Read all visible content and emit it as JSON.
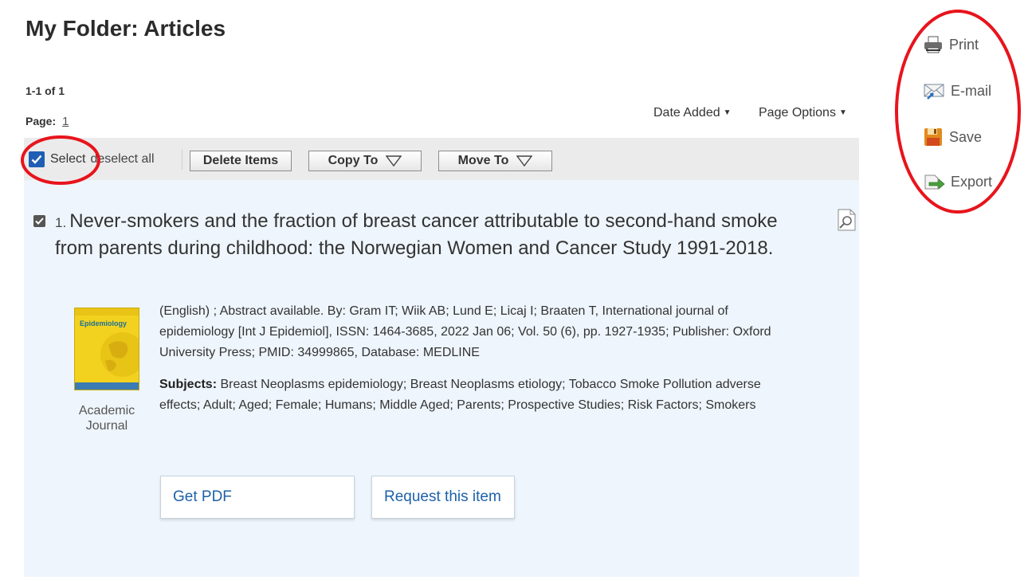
{
  "page": {
    "title": "My Folder: Articles"
  },
  "results_header": {
    "count_text": "1-1 of 1",
    "page_label": "Page:",
    "page_number": "1",
    "sort_label": "Date Added",
    "page_options_label": "Page Options"
  },
  "toolbar": {
    "select_label": "Select",
    "deselect_label": "deselect all",
    "delete_label": "Delete Items",
    "copy_label": "Copy To",
    "move_label": "Move To"
  },
  "result": {
    "number": "1.",
    "title": "Never-smokers and the fraction of breast cancer attributable to second-hand smoke from parents during childhood: the Norwegian Women and Cancer Study 1991-2018.",
    "details": "(English) ; Abstract available. By: Gram IT; Wiik AB; Lund E; Licaj I; Braaten T, International journal of epidemiology [Int J Epidemiol], ISSN: 1464-3685, 2022 Jan 06; Vol. 50 (6), pp. 1927-1935; Publisher: Oxford University Press; PMID: 34999865, Database: MEDLINE",
    "subjects_label": "Subjects:",
    "subjects": "Breast Neoplasms epidemiology; Breast Neoplasms etiology; Tobacco Smoke Pollution adverse effects; Adult; Aged; Female; Humans; Middle Aged; Parents; Prospective Studies; Risk Factors; Smokers",
    "publication_type": "Academic Journal",
    "cover_text": "Epidemiology",
    "get_pdf_label": "Get PDF",
    "request_label": "Request this item"
  },
  "tools": {
    "print": "Print",
    "email": "E-mail",
    "save": "Save",
    "export": "Export"
  },
  "colors": {
    "checkbox": "#1f5fb3",
    "link": "#1d61a8",
    "panel": "#eef5fc",
    "annotation": "#e8141c"
  }
}
